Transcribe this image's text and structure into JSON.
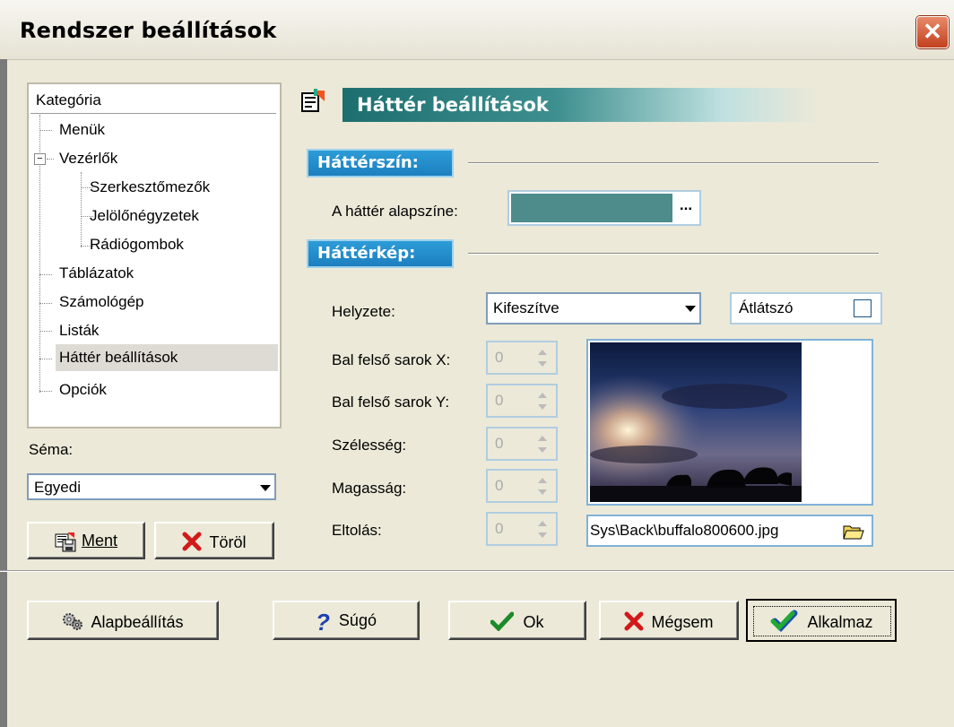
{
  "window": {
    "title": "Rendszer beállítások",
    "close_glyph": "✕"
  },
  "tree": {
    "header": "Kategória",
    "items": [
      {
        "label": "Menük"
      },
      {
        "label": "Vezérlők",
        "expander": "−"
      },
      {
        "label": "Szerkesztőmezők"
      },
      {
        "label": "Jelölőnégyzetek"
      },
      {
        "label": "Rádiógombok"
      },
      {
        "label": "Táblázatok"
      },
      {
        "label": "Számológép"
      },
      {
        "label": "Listák"
      },
      {
        "label": "Háttér beállítások"
      },
      {
        "label": "Opciók"
      }
    ]
  },
  "schema": {
    "label": "Séma:",
    "value": "Egyedi"
  },
  "left_buttons": {
    "save": "Ment",
    "delete": "Töröl"
  },
  "page": {
    "title": "Háttér beállítások"
  },
  "section_color": {
    "title": "Háttérszín:",
    "base_color_label": "A háttér alapszíne:",
    "base_color": "#4e8c8c",
    "browse_glyph": "..."
  },
  "section_image": {
    "title": "Háttérkép:",
    "position_label": "Helyzete:",
    "position_value": "Kifeszítve",
    "transparent_label": "Átlátszó",
    "x_label": "Bal felső sarok X:",
    "y_label": "Bal felső sarok Y:",
    "width_label": "Szélesség:",
    "height_label": "Magasság:",
    "offset_label": "Eltolás:",
    "x_value": "0",
    "y_value": "0",
    "width_value": "0",
    "height_value": "0",
    "offset_value": "0",
    "file_path": "Sys\\Back\\buffalo800600.jpg"
  },
  "bottom_buttons": {
    "default": "Alapbeállítás",
    "help": "Súgó",
    "ok": "Ok",
    "cancel": "Mégsem",
    "apply": "Alkalmaz"
  }
}
